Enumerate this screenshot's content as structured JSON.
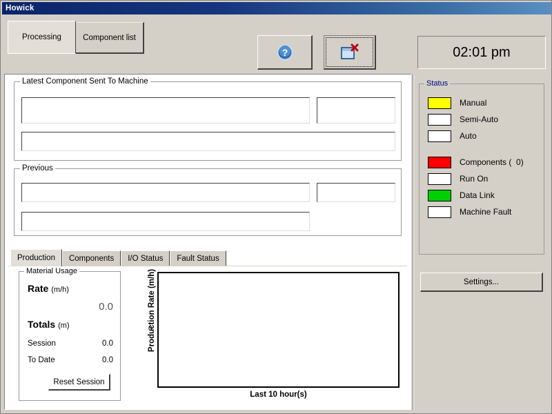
{
  "window": {
    "title": "Howick"
  },
  "toolbar": {
    "tabs": [
      {
        "label": "Processing",
        "active": true
      },
      {
        "label": "Component list",
        "active": false
      }
    ],
    "help_button": {
      "icon": "help-circle-icon",
      "label": ""
    },
    "close_button": {
      "icon": "window-close-icon",
      "label": ""
    },
    "clock": "02:01 pm"
  },
  "latest_component": {
    "legend": "Latest Component Sent To Machine",
    "field_main": "",
    "field_side": "",
    "field_lower": ""
  },
  "previous": {
    "legend": "Previous",
    "field_main": "",
    "field_side": "",
    "field_lower": ""
  },
  "bottom_tabs": [
    {
      "label": "Production",
      "active": true
    },
    {
      "label": "Components",
      "active": false
    },
    {
      "label": "I/O Status",
      "active": false
    },
    {
      "label": "Fault Status",
      "active": false
    }
  ],
  "material_usage": {
    "legend": "Material Usage",
    "rate_label": "Rate",
    "rate_unit": "(m/h)",
    "rate_value": "0.0",
    "totals_label": "Totals",
    "totals_unit": "(m)",
    "session_label": "Session",
    "session_value": "0.0",
    "to_date_label": "To Date",
    "to_date_value": "0.0",
    "reset_button": "Reset Session"
  },
  "chart_data": {
    "type": "line",
    "title": "",
    "xlabel": "Last 10 hour(s)",
    "ylabel": "Production Rate (m/h)",
    "x": [],
    "values": [],
    "series": [],
    "yticks": [
      "0"
    ],
    "xticks": [],
    "ylim": [
      0,
      0
    ],
    "grid": false,
    "legend": "none"
  },
  "status": {
    "legend": "Status",
    "items": [
      {
        "label": "Manual",
        "color": "#ffff00"
      },
      {
        "label": "Semi-Auto",
        "color": "#ffffff"
      },
      {
        "label": "Auto",
        "color": "#ffffff"
      },
      {
        "label": "Components (  0)",
        "color": "#ff0000"
      },
      {
        "label": "Run On",
        "color": "#ffffff"
      },
      {
        "label": "Data Link",
        "color": "#00d000"
      },
      {
        "label": "Machine Fault",
        "color": "#ffffff"
      }
    ]
  },
  "sidebar": {
    "settings_button": "Settings..."
  },
  "colors": {
    "face": "#d4d0c8",
    "titlebar_start": "#0a246a",
    "titlebar_end": "#5a8fc2",
    "legend_text": "#000080",
    "field_bg": "#ffffff"
  }
}
